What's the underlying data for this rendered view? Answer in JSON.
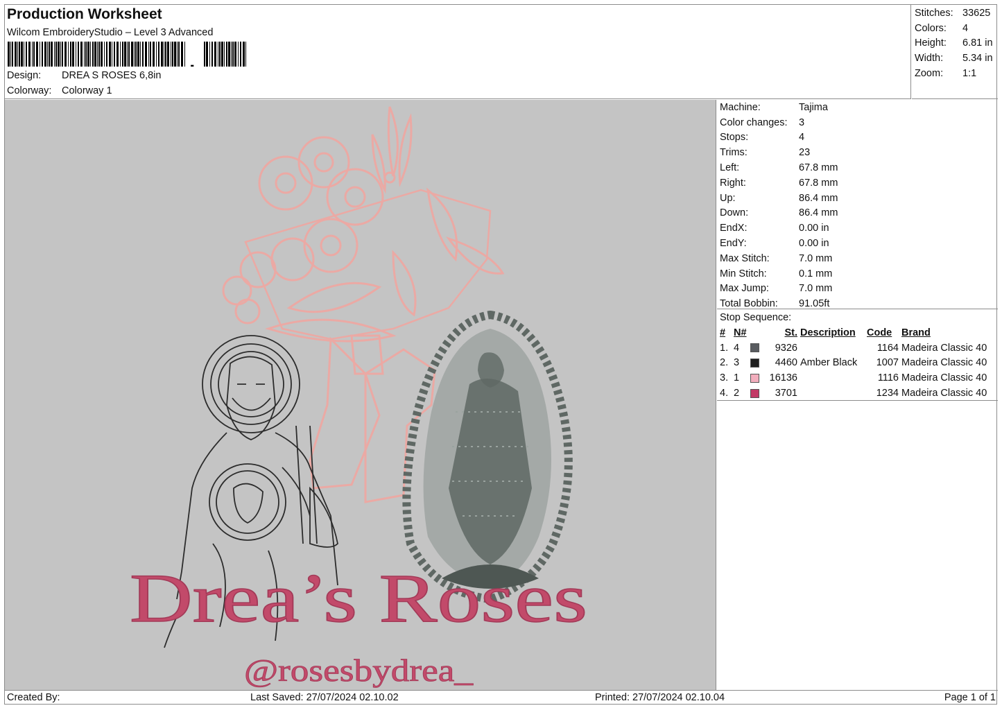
{
  "header": {
    "title": "Production Worksheet",
    "subtitle": "Wilcom EmbroideryStudio – Level 3 Advanced",
    "design_label": "Design:",
    "design_value": "DREA S ROSES 6,8in",
    "colorway_label": "Colorway:",
    "colorway_value": "Colorway 1"
  },
  "stats": [
    {
      "label": "Stitches:",
      "value": "33625"
    },
    {
      "label": "Colors:",
      "value": "4"
    },
    {
      "label": "Height:",
      "value": "6.81 in"
    },
    {
      "label": "Width:",
      "value": "5.34 in"
    },
    {
      "label": "Zoom:",
      "value": "1:1"
    }
  ],
  "machine": [
    {
      "label": "Machine:",
      "value": "Tajima"
    },
    {
      "label": "Color changes:",
      "value": "3"
    },
    {
      "label": "Stops:",
      "value": "4"
    },
    {
      "label": "Trims:",
      "value": "23"
    },
    {
      "label": "Left:",
      "value": "67.8 mm"
    },
    {
      "label": "Right:",
      "value": "67.8 mm"
    },
    {
      "label": "Up:",
      "value": "86.4 mm"
    },
    {
      "label": "Down:",
      "value": "86.4 mm"
    },
    {
      "label": "EndX:",
      "value": "0.00 in"
    },
    {
      "label": "EndY:",
      "value": "0.00 in"
    },
    {
      "label": "Max Stitch:",
      "value": "7.0 mm"
    },
    {
      "label": "Min Stitch:",
      "value": "0.1 mm"
    },
    {
      "label": "Max Jump:",
      "value": "7.0 mm"
    },
    {
      "label": "Total Bobbin:",
      "value": "91.05ft"
    }
  ],
  "stop_sequence": {
    "title": "Stop Sequence:",
    "columns": {
      "num": "#",
      "n": "N#",
      "st": "St.",
      "desc": "Description",
      "code": "Code",
      "brand": "Brand"
    },
    "rows": [
      {
        "num": "1.",
        "n": "4",
        "color": "#595c60",
        "st": "9326",
        "desc": "",
        "code": "1164",
        "brand": "Madeira Classic 40"
      },
      {
        "num": "2.",
        "n": "3",
        "color": "#1e1e1e",
        "st": "4460",
        "desc": "Amber Black",
        "code": "1007",
        "brand": "Madeira Classic 40"
      },
      {
        "num": "3.",
        "n": "1",
        "color": "#f2aebd",
        "st": "16136",
        "desc": "",
        "code": "1116",
        "brand": "Madeira Classic 40"
      },
      {
        "num": "4.",
        "n": "2",
        "color": "#c23a66",
        "st": "3701",
        "desc": "",
        "code": "1234",
        "brand": "Madeira Classic 40"
      }
    ]
  },
  "design_preview": {
    "main_text": "Drea’s Roses",
    "handle_text": "@rosesbydrea_",
    "colors": {
      "background": "#c4c4c4",
      "pink_outline": "#eba9a4",
      "text_pink": "#c24a6a",
      "dark_gray": "#5f6864",
      "black_line": "#2c2c2c"
    }
  },
  "footer": {
    "created_by": "Created By:",
    "last_saved": "Last Saved: 27/07/2024 02.10.02",
    "printed": "Printed: 27/07/2024 02.10.04",
    "page": "Page 1 of 1"
  }
}
